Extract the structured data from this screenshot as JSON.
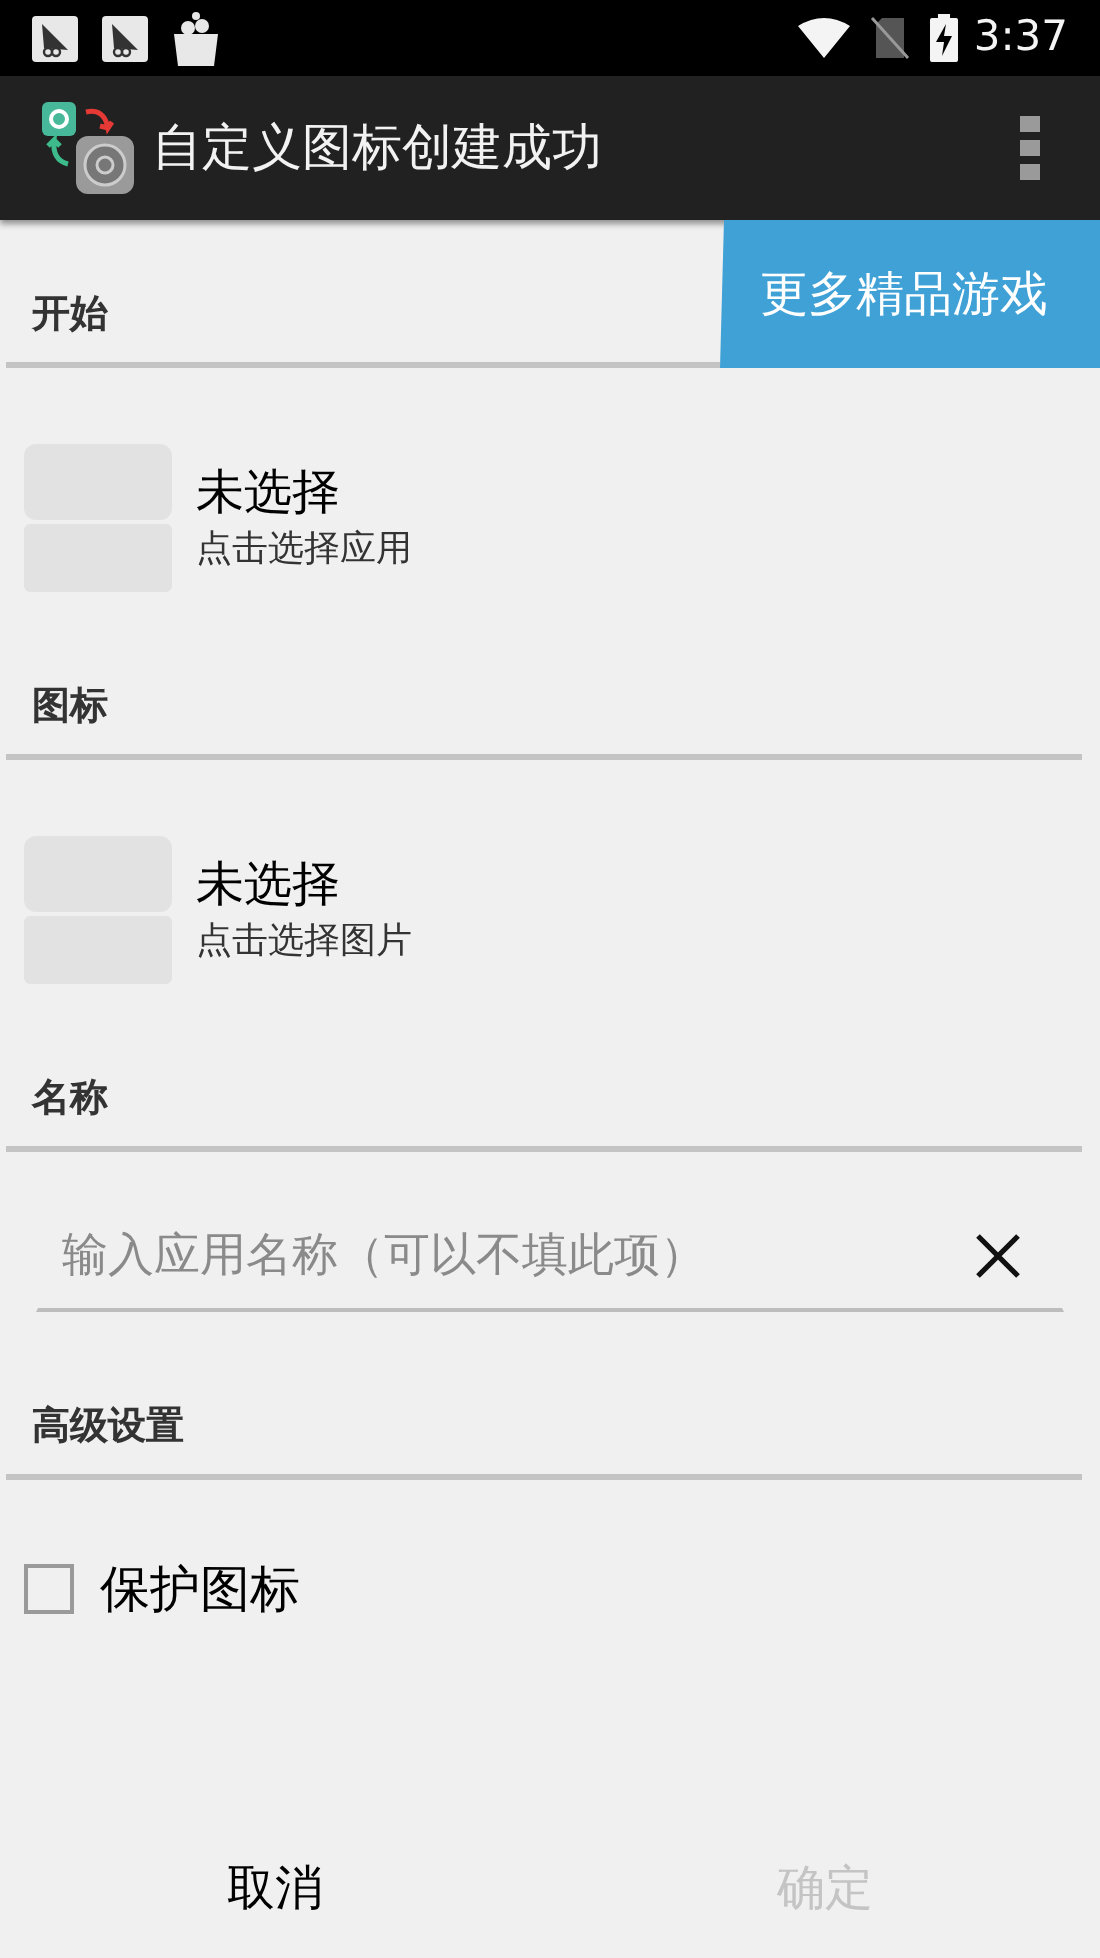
{
  "status_bar": {
    "time": "3:37"
  },
  "app_bar": {
    "title": "自定义图标创建成功"
  },
  "promo_button": {
    "label": "更多精品游戏"
  },
  "sections": [
    {
      "kind": "picker",
      "title": "开始",
      "label": "未选择",
      "hint": "点击选择应用"
    },
    {
      "kind": "picker",
      "title": "图标",
      "label": "未选择",
      "hint": "点击选择图片"
    },
    {
      "kind": "text_input",
      "title": "名称",
      "placeholder": "输入应用名称（可以不填此项）"
    },
    {
      "kind": "checkbox",
      "title": "高级设置",
      "label": "保护图标",
      "checked": false
    }
  ],
  "buttons": [
    {
      "label": "取消",
      "disabled": false
    },
    {
      "label": "确定",
      "disabled": true
    }
  ]
}
